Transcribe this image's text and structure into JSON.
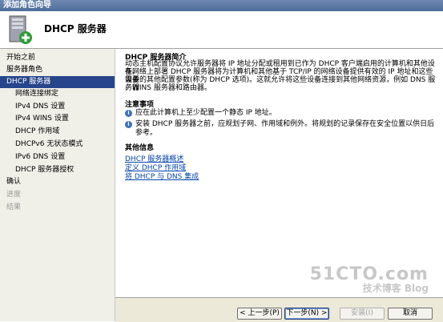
{
  "window": {
    "title": "添加角色向导"
  },
  "header": {
    "title": "DHCP 服务器"
  },
  "sidebar": {
    "items": [
      {
        "label": "开始之前"
      },
      {
        "label": "服务器角色"
      },
      {
        "label": "DHCP 服务器"
      },
      {
        "label": "网络连接绑定"
      },
      {
        "label": "IPv4 DNS 设置"
      },
      {
        "label": "IPv4 WINS 设置"
      },
      {
        "label": "DHCP 作用域"
      },
      {
        "label": "DHCPv6 无状态模式"
      },
      {
        "label": "IPv6 DNS 设置"
      },
      {
        "label": "DHCP 服务器授权"
      },
      {
        "label": "确认"
      },
      {
        "label": "进度"
      },
      {
        "label": "结果"
      }
    ]
  },
  "main": {
    "intro_title": "DHCP 服务器简介",
    "intro_lines": [
      "动态主机配置协议允许服务器将 IP 地址分配或租用到已作为 DHCP 客户端启用的计算机和其他设备。",
      "在网络上部署 DHCP 服务器将为计算机和其他基于 TCP/IP 的网络设备提供有效的 IP 地址和这些设备",
      "需要的其他配置参数(称为 DHCP 选项)。这就允许将这些设备连接到其他网络资源，例如 DNS 服务器",
      "、WINS 服务器和路由器。"
    ],
    "notes_title": "注意事项",
    "notes": [
      "应在此计算机上至少配置一个静态 IP 地址。",
      "安装 DHCP 服务器之前，应规划子网、作用域和例外。将规划的记录保存在安全位置以供日后参考。"
    ],
    "other_title": "其他信息",
    "links": [
      "DHCP 服务器概述",
      "定义 DHCP 作用域",
      "将 DHCP 与 DNS 集成"
    ]
  },
  "footer": {
    "back": "< 上一步(P)",
    "next": "下一步(N) >",
    "install": "安装(I)",
    "cancel": "取消"
  },
  "watermark": {
    "main": "51CTO.com",
    "sub": "技术博客 Blog"
  }
}
